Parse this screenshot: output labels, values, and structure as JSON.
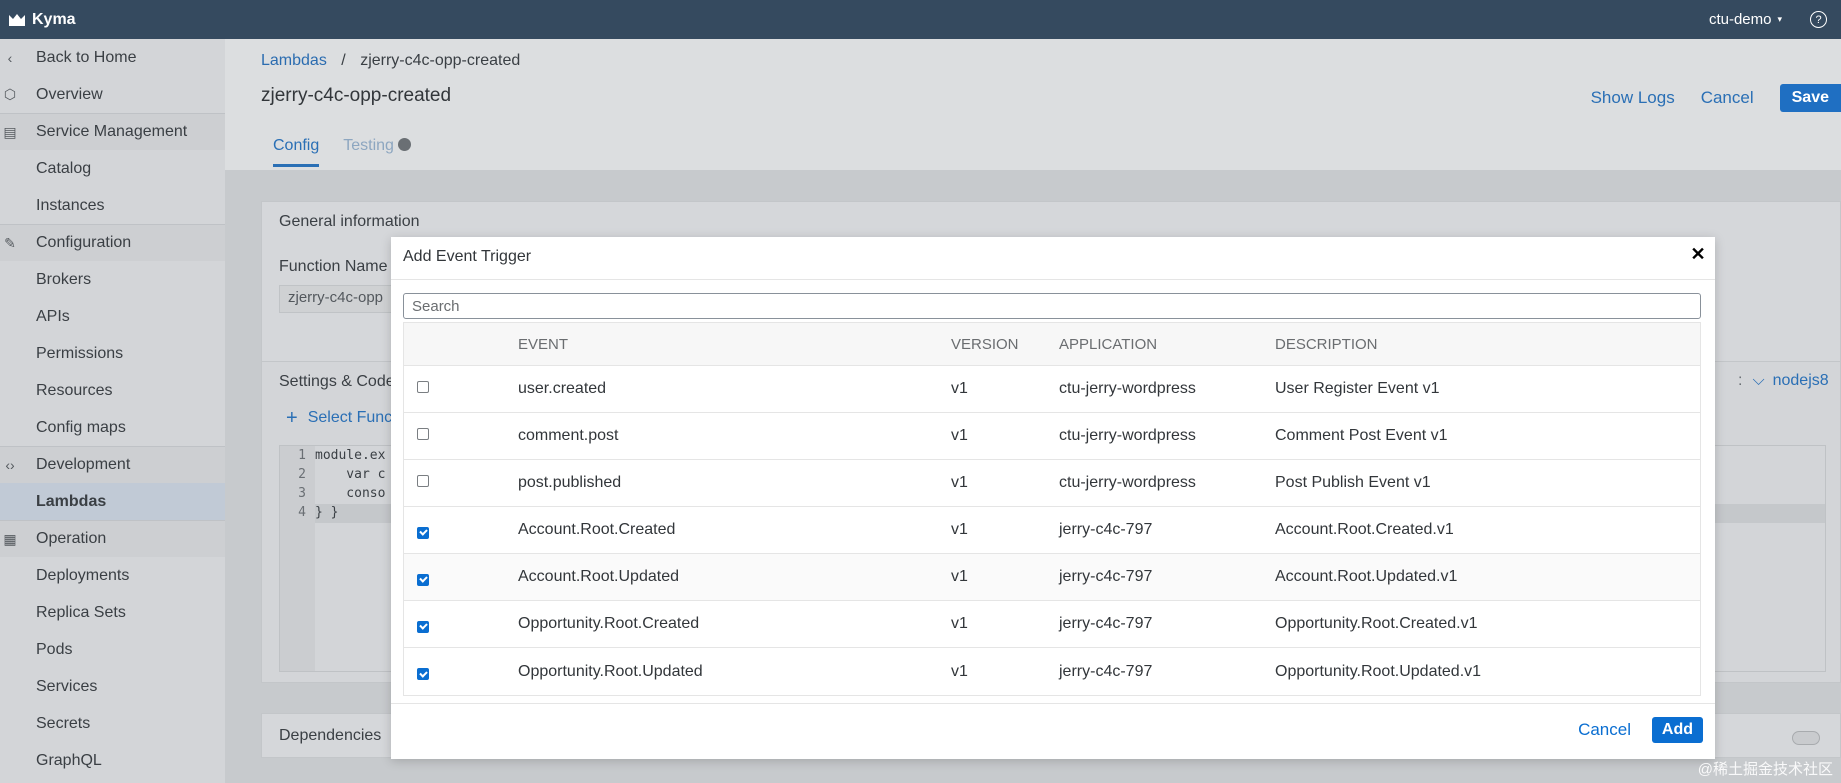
{
  "topbar": {
    "brand": "Kyma",
    "namespace": "ctu-demo",
    "help": "?"
  },
  "sidebar": {
    "items": [
      {
        "label": "Back to Home",
        "type": "top",
        "icon": "chevron-left-icon"
      },
      {
        "label": "Overview",
        "type": "top",
        "icon": "overview-icon"
      },
      {
        "label": "Service Management",
        "type": "group",
        "icon": "service-icon"
      },
      {
        "label": "Catalog",
        "type": "sub"
      },
      {
        "label": "Instances",
        "type": "sub"
      },
      {
        "label": "Configuration",
        "type": "group",
        "icon": "edit-icon"
      },
      {
        "label": "Brokers",
        "type": "sub"
      },
      {
        "label": "APIs",
        "type": "sub"
      },
      {
        "label": "Permissions",
        "type": "sub"
      },
      {
        "label": "Resources",
        "type": "sub"
      },
      {
        "label": "Config maps",
        "type": "sub"
      },
      {
        "label": "Development",
        "type": "group",
        "icon": "code-icon"
      },
      {
        "label": "Lambdas",
        "type": "sub",
        "active": true
      },
      {
        "label": "Operation",
        "type": "group",
        "icon": "operation-icon"
      },
      {
        "label": "Deployments",
        "type": "sub"
      },
      {
        "label": "Replica Sets",
        "type": "sub"
      },
      {
        "label": "Pods",
        "type": "sub"
      },
      {
        "label": "Services",
        "type": "sub"
      },
      {
        "label": "Secrets",
        "type": "sub"
      },
      {
        "label": "GraphQL",
        "type": "sub"
      }
    ]
  },
  "header": {
    "breadcrumb_link": "Lambdas",
    "breadcrumb_sep": "/",
    "breadcrumb_current": "zjerry-c4c-opp-created",
    "title": "zjerry-c4c-opp-created",
    "show_logs": "Show Logs",
    "cancel": "Cancel",
    "save": "Save",
    "tabs": [
      "Config",
      "Testing"
    ]
  },
  "background": {
    "general_info": "General information",
    "function_name_label": "Function Name",
    "function_name_value": "zjerry-c4c-opp",
    "settings_code": "Settings & Code",
    "select_function": "Select Func",
    "runtime": "nodejs8",
    "dependencies": "Dependencies",
    "code_lines": [
      {
        "n": "1",
        "text": "module.ex"
      },
      {
        "n": "2",
        "text": "    var c"
      },
      {
        "n": "3",
        "text": "    conso"
      },
      {
        "n": "4",
        "text": "} }"
      }
    ]
  },
  "modal": {
    "title": "Add Event Trigger",
    "search_placeholder": "Search",
    "columns": [
      "EVENT",
      "VERSION",
      "APPLICATION",
      "DESCRIPTION"
    ],
    "rows": [
      {
        "checked": false,
        "event": "user.created",
        "version": "v1",
        "application": "ctu-jerry-wordpress",
        "description": "User Register Event v1"
      },
      {
        "checked": false,
        "event": "comment.post",
        "version": "v1",
        "application": "ctu-jerry-wordpress",
        "description": "Comment Post Event v1"
      },
      {
        "checked": false,
        "event": "post.published",
        "version": "v1",
        "application": "ctu-jerry-wordpress",
        "description": "Post Publish Event v1"
      },
      {
        "checked": true,
        "event": "Account.Root.Created",
        "version": "v1",
        "application": "jerry-c4c-797",
        "description": "Account.Root.Created.v1"
      },
      {
        "checked": true,
        "event": "Account.Root.Updated",
        "version": "v1",
        "application": "jerry-c4c-797",
        "description": "Account.Root.Updated.v1"
      },
      {
        "checked": true,
        "event": "Opportunity.Root.Created",
        "version": "v1",
        "application": "jerry-c4c-797",
        "description": "Opportunity.Root.Created.v1"
      },
      {
        "checked": true,
        "event": "Opportunity.Root.Updated",
        "version": "v1",
        "application": "jerry-c4c-797",
        "description": "Opportunity.Root.Updated.v1"
      }
    ],
    "cancel": "Cancel",
    "add": "Add"
  },
  "watermark": "@稀土掘金技术社区",
  "colors": {
    "topbar": "#354a5f",
    "accent": "#0a6ed1",
    "link": "#2a6fb5"
  }
}
